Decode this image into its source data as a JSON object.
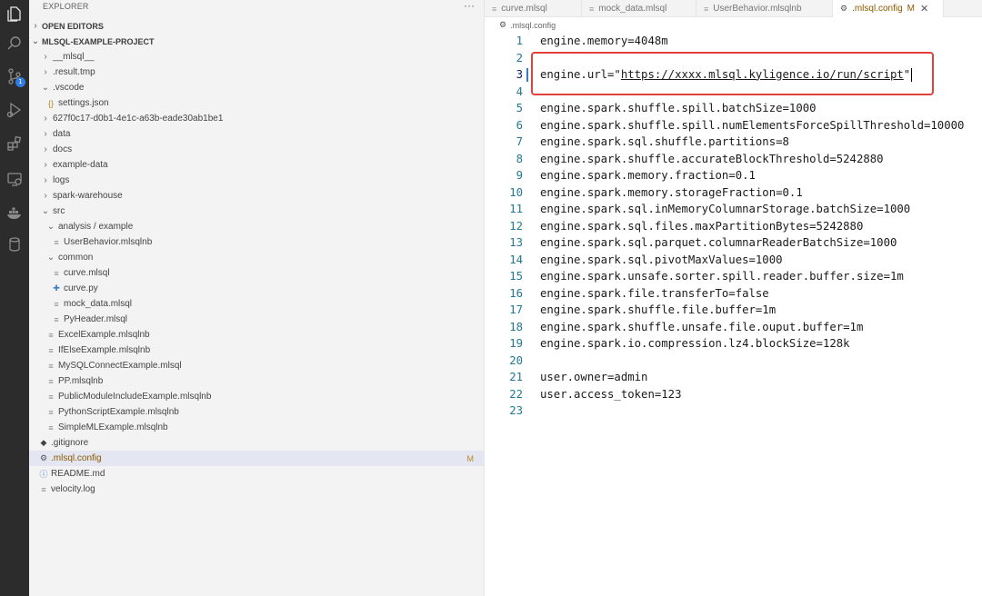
{
  "activity_bar": {
    "icons": [
      "explorer-icon",
      "search-icon",
      "source-control-icon",
      "run-debug-icon",
      "extensions-icon",
      "remote-explorer-icon",
      "docker-icon",
      "database-icon"
    ],
    "source_control_badge": "1"
  },
  "sidebar": {
    "title": "EXPLORER",
    "more": "···",
    "sections": {
      "open_editors": "OPEN EDITORS",
      "project": "MLSQL-EXAMPLE-PROJECT"
    },
    "tree": [
      {
        "label": "__mlsql__",
        "type": "folder",
        "open": false
      },
      {
        "label": ".result.tmp",
        "type": "folder",
        "open": false
      },
      {
        "label": ".vscode",
        "type": "folder",
        "open": true
      },
      {
        "label": "settings.json",
        "type": "json-file"
      },
      {
        "label": "627f0c17-d0b1-4e1c-a63b-eade30ab1be1",
        "type": "folder",
        "open": false
      },
      {
        "label": "data",
        "type": "folder",
        "open": false
      },
      {
        "label": "docs",
        "type": "folder",
        "open": false
      },
      {
        "label": "example-data",
        "type": "folder",
        "open": false
      },
      {
        "label": "logs",
        "type": "folder",
        "open": false
      },
      {
        "label": "spark-warehouse",
        "type": "folder",
        "open": false
      },
      {
        "label": "src",
        "type": "folder",
        "open": true
      },
      {
        "label": "analysis / example",
        "type": "folder",
        "open": true
      },
      {
        "label": "UserBehavior.mlsqlnb",
        "type": "file"
      },
      {
        "label": "common",
        "type": "folder",
        "open": true
      },
      {
        "label": "curve.mlsql",
        "type": "file"
      },
      {
        "label": "curve.py",
        "type": "python-file"
      },
      {
        "label": "mock_data.mlsql",
        "type": "file"
      },
      {
        "label": "PyHeader.mlsql",
        "type": "file"
      },
      {
        "label": "ExcelExample.mlsqlnb",
        "type": "file"
      },
      {
        "label": "IfElseExample.mlsqlnb",
        "type": "file"
      },
      {
        "label": "MySQLConnectExample.mlsql",
        "type": "file"
      },
      {
        "label": "PP.mlsqlnb",
        "type": "file"
      },
      {
        "label": "PublicModuleIncludeExample.mlsqlnb",
        "type": "file"
      },
      {
        "label": "PythonScriptExample.mlsqlnb",
        "type": "file"
      },
      {
        "label": "SimpleMLExample.mlsqlnb",
        "type": "file"
      },
      {
        "label": ".gitignore",
        "type": "git-file"
      },
      {
        "label": ".mlsql.config",
        "type": "config-file",
        "selected": true,
        "status": "M"
      },
      {
        "label": "README.md",
        "type": "info-file"
      },
      {
        "label": "velocity.log",
        "type": "file"
      }
    ]
  },
  "editor": {
    "tabs": [
      {
        "label": "curve.mlsql",
        "active": false
      },
      {
        "label": "mock_data.mlsql",
        "active": false
      },
      {
        "label": "UserBehavior.mlsqlnb",
        "active": false
      },
      {
        "label": ".mlsql.config",
        "active": true,
        "modified": "M",
        "close": "✕"
      }
    ],
    "breadcrumb": ".mlsql.config",
    "lines": [
      {
        "n": "1",
        "text": "engine.memory=4048m"
      },
      {
        "n": "2",
        "text": ""
      },
      {
        "n": "3",
        "text": "engine.url=\"https://xxxx.mlsql.kyligence.io/run/script\"",
        "current": true
      },
      {
        "n": "4",
        "text": ""
      },
      {
        "n": "5",
        "text": "engine.spark.shuffle.spill.batchSize=1000"
      },
      {
        "n": "6",
        "text": "engine.spark.shuffle.spill.numElementsForceSpillThreshold=10000"
      },
      {
        "n": "7",
        "text": "engine.spark.sql.shuffle.partitions=8"
      },
      {
        "n": "8",
        "text": "engine.spark.shuffle.accurateBlockThreshold=5242880"
      },
      {
        "n": "9",
        "text": "engine.spark.memory.fraction=0.1"
      },
      {
        "n": "10",
        "text": "engine.spark.memory.storageFraction=0.1"
      },
      {
        "n": "11",
        "text": "engine.spark.sql.inMemoryColumnarStorage.batchSize=1000"
      },
      {
        "n": "12",
        "text": "engine.spark.sql.files.maxPartitionBytes=5242880"
      },
      {
        "n": "13",
        "text": "engine.spark.sql.parquet.columnarReaderBatchSize=1000"
      },
      {
        "n": "14",
        "text": "engine.spark.sql.pivotMaxValues=1000"
      },
      {
        "n": "15",
        "text": "engine.spark.unsafe.sorter.spill.reader.buffer.size=1m"
      },
      {
        "n": "16",
        "text": "engine.spark.file.transferTo=false"
      },
      {
        "n": "17",
        "text": "engine.spark.shuffle.file.buffer=1m"
      },
      {
        "n": "18",
        "text": "engine.spark.shuffle.unsafe.file.ouput.buffer=1m"
      },
      {
        "n": "19",
        "text": "engine.spark.io.compression.lz4.blockSize=128k"
      },
      {
        "n": "20",
        "text": ""
      },
      {
        "n": "21",
        "text": "user.owner=admin"
      },
      {
        "n": "22",
        "text": "user.access_token=123"
      },
      {
        "n": "23",
        "text": ""
      }
    ],
    "url_line": {
      "prefix": "engine.url=\"",
      "url": "https://xxxx.mlsql.kyligence.io/run/script",
      "suffix": "\""
    }
  },
  "colors": {
    "activity_bg": "#2c2c2c",
    "sidebar_bg": "#f3f3f3",
    "accent": "#2f7de1",
    "highlight_box": "#e0423b",
    "modified": "#b58a24"
  }
}
